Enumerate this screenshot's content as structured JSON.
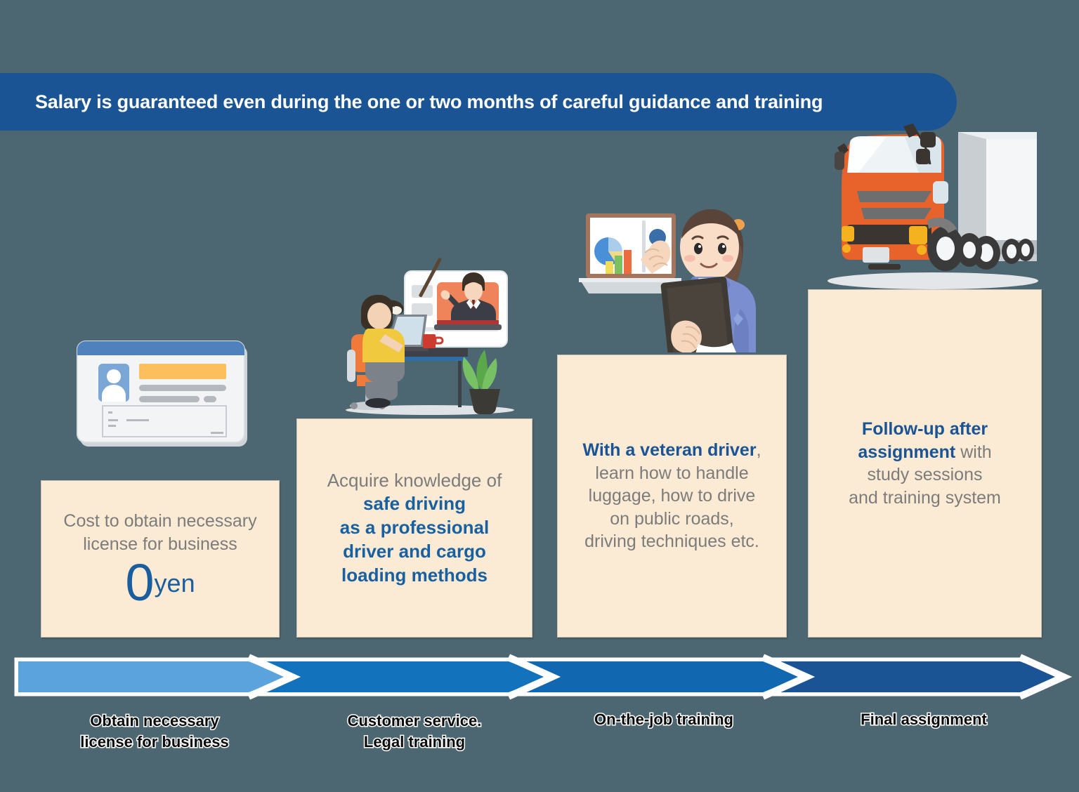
{
  "banner": {
    "text": "Salary is guaranteed even during the one or two months of careful guidance and training",
    "color": "#1a5494"
  },
  "colors": {
    "background": "#4c6771",
    "card_bg": "#fbead4",
    "gray_text": "#7c7c7c",
    "blue_text": "#18609f",
    "arrow_1": "#5ba3dc",
    "arrow_2": "#1272bc",
    "arrow_3": "#1168b0",
    "arrow_4": "#1a5494",
    "truck_orange": "#e8622c"
  },
  "cards": [
    {
      "id": "card1",
      "line1": "Cost to obtain necessary",
      "line2": "license for business",
      "amount": "0",
      "amount_unit": "yen"
    },
    {
      "id": "card2",
      "line1": "Acquire knowledge of",
      "line2": "safe driving",
      "line3": "as a professional",
      "line4": "driver and cargo",
      "line5": "loading methods"
    },
    {
      "id": "card3",
      "line1_bold": "With a veteran driver",
      "line1_rest": ",",
      "line2": "learn how to handle",
      "line3": "luggage, how to drive",
      "line4": "on public roads,",
      "line5": "driving techniques etc."
    },
    {
      "id": "card4",
      "line1_bold": "Follow-up after",
      "line2_bold": "assignment",
      "line2_rest": " with",
      "line3": "study sessions",
      "line4": "and training system"
    }
  ],
  "steps": [
    {
      "line1": "Obtain necessary",
      "line2": "license for business"
    },
    {
      "line1": "Customer service.",
      "line2": "Legal training"
    },
    {
      "line1": "On-the-job training",
      "line2": ""
    },
    {
      "line1": "Final assignment",
      "line2": ""
    }
  ],
  "illustrations": [
    {
      "name": "id-card-illustration",
      "alt": "identification license card"
    },
    {
      "name": "e-learning-illustration",
      "alt": "student at desk watching online instructor"
    },
    {
      "name": "presenter-illustration",
      "alt": "woman presenting charts on whiteboard"
    },
    {
      "name": "truck-illustration",
      "alt": "orange cargo truck"
    }
  ]
}
